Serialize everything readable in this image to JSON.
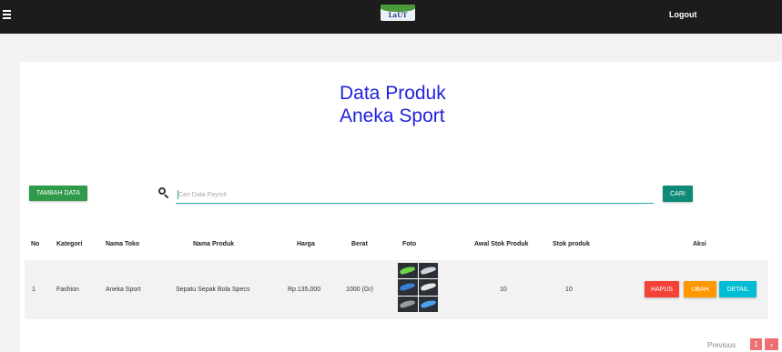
{
  "topbar": {
    "logo_text": "LaUT",
    "logout_label": "Logout"
  },
  "page": {
    "title_line1": "Data Produk",
    "title_line2": "Aneka Sport"
  },
  "actions": {
    "add_label": "TAMBAH DATA",
    "search_placeholder": "Cari Data Payroll",
    "search_value": "",
    "search_button_label": "CARI"
  },
  "table": {
    "headers": [
      "No",
      "Kategori",
      "Nama Toko",
      "Nama Produk",
      "Harga",
      "Berat",
      "Foto",
      "Awal Stok Produk",
      "Stok produk",
      "Aksi"
    ],
    "rows": [
      {
        "no": "1",
        "kategori": "Fashion",
        "nama_toko": "Aneka Sport",
        "nama_produk": "Sepatu Sepak Bola Specs",
        "harga": "Rp.135,000",
        "berat": "1000 (Gr)",
        "awal_stok": "10",
        "stok": "10",
        "actions": {
          "hapus": "HAPUS",
          "ubah": "UBAH",
          "detail": "DETAIL"
        }
      }
    ]
  },
  "pagination": {
    "previous_label": "Previous",
    "current_page": "1",
    "next_icon": "›"
  },
  "colors": {
    "topbar": "#1c1c1c",
    "title": "#2222dd",
    "add_button": "#2e9a4a",
    "search_button": "#0f8a78",
    "hapus": "#f44336",
    "ubah": "#ff9800",
    "detail": "#00bcd4",
    "pagination": "#ee6e73"
  }
}
